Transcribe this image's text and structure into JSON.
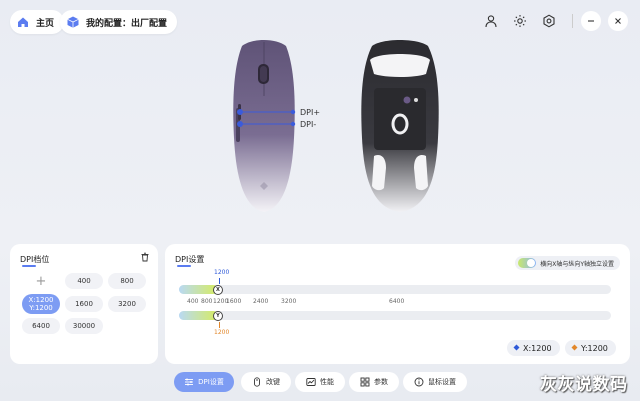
{
  "header": {
    "home_label": "主页",
    "config_label": "我的配置：出厂配置"
  },
  "mouse": {
    "dpi_plus_label": "DPI+",
    "dpi_minus_label": "DPI-"
  },
  "dpi_slots": {
    "title": "DPI档位",
    "add_symbol": "+",
    "items": [
      {
        "label": "400"
      },
      {
        "label": "800"
      },
      {
        "label_x": "X:1200",
        "label_y": "Y:1200",
        "active": true
      },
      {
        "label": "1600"
      },
      {
        "label": "3200"
      },
      {
        "label": "6400"
      },
      {
        "label": "30000"
      }
    ]
  },
  "dpi_settings": {
    "title": "DPI设置",
    "toggle_label": "横向X轴与纵向Y轴独立设置",
    "x_value_top": "1200",
    "y_value_bottom": "1200",
    "x_thumb_letter": "X",
    "y_thumb_letter": "Y",
    "ticks": [
      "400",
      "800",
      "1200",
      "1600",
      "2400",
      "3200",
      "6400"
    ],
    "x_fill_fraction": 0.09,
    "y_fill_fraction": 0.09,
    "x_coord": "X:1200",
    "y_coord": "Y:1200"
  },
  "nav": {
    "items": [
      {
        "label": "DPI设置",
        "active": true
      },
      {
        "label": "改键"
      },
      {
        "label": "性能"
      },
      {
        "label": "参数"
      },
      {
        "label": "鼠标设置"
      }
    ]
  },
  "watermark": "灰灰说数码",
  "colors": {
    "accent": "#7d9cf3",
    "x_value": "#2f5ad8",
    "y_value": "#e2872a"
  }
}
